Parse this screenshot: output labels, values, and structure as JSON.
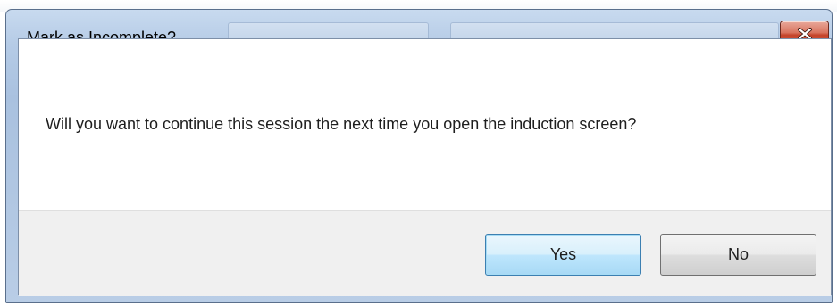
{
  "dialog": {
    "title": "Mark as Incomplete?",
    "message": "Will you want to continue this session the next time you open the induction screen?",
    "buttons": {
      "yes": "Yes",
      "no": "No"
    },
    "close_icon": "close-icon"
  },
  "colors": {
    "frame": "#b5cbe6",
    "close_button": "#c4432a",
    "default_button_border": "#3c7fb1",
    "footer": "#f0f0f0"
  }
}
